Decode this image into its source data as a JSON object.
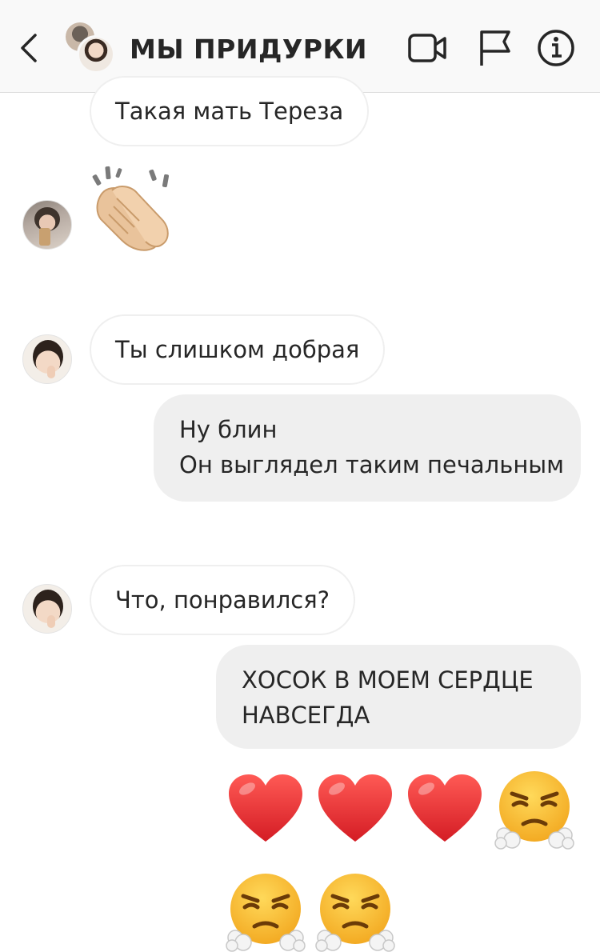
{
  "header": {
    "title": "МЫ ПРИДУРКИ",
    "icons": [
      "chevron-left-icon",
      "video-camera-icon",
      "flag-icon",
      "info-icon"
    ]
  },
  "messages": [
    {
      "direction": "incoming",
      "text": "Такая мать Тереза"
    },
    {
      "direction": "incoming",
      "emoji": "clapping-hands"
    },
    {
      "direction": "incoming",
      "text": "Ты слишком добрая"
    },
    {
      "direction": "outgoing",
      "lines": [
        "Ну блин",
        "Он выглядел таким печальным"
      ]
    },
    {
      "direction": "incoming",
      "text": "Что, понравился?"
    },
    {
      "direction": "outgoing",
      "lines": [
        "ХОСОК В МОЕМ СЕРДЦЕ",
        "НАВСЕГДА"
      ]
    },
    {
      "direction": "outgoing",
      "emoji_row_1": [
        "red-heart",
        "red-heart",
        "red-heart",
        "face-with-steam"
      ]
    },
    {
      "direction": "outgoing",
      "emoji_row_2": [
        "face-with-steam",
        "face-with-steam"
      ]
    }
  ],
  "colors": {
    "header_bg": "#f9f9f9",
    "outgoing_bubble": "#efefef",
    "incoming_border": "#efefef",
    "text": "#262626",
    "heart": "#e8222a",
    "steam_face": "#f7b52c"
  }
}
